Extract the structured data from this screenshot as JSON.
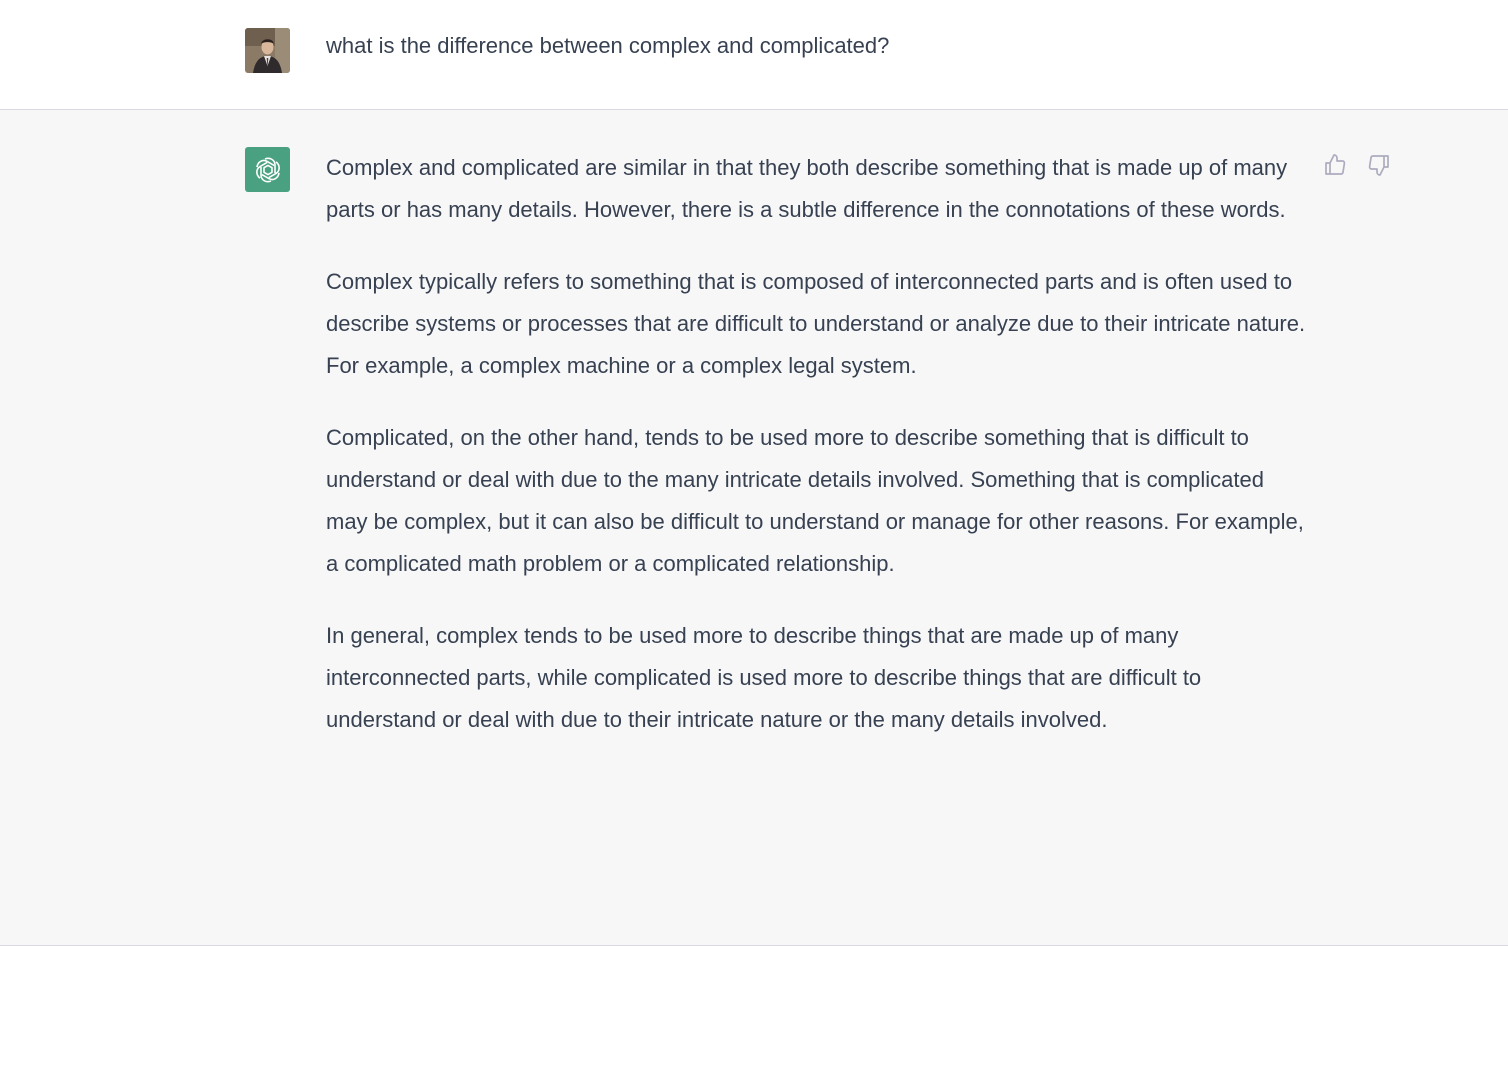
{
  "user_message": {
    "text": "what is the difference between complex and complicated?"
  },
  "assistant_message": {
    "paragraphs": [
      "Complex and complicated are similar in that they both describe something that is made up of many parts or has many details. However, there is a subtle difference in the connotations of these words.",
      "Complex typically refers to something that is composed of interconnected parts and is often used to describe systems or processes that are difficult to understand or analyze due to their intricate nature. For example, a complex machine or a complex legal system.",
      "Complicated, on the other hand, tends to be used more to describe something that is difficult to understand or deal with due to the many intricate details involved. Something that is complicated may be complex, but it can also be difficult to understand or manage for other reasons. For example, a complicated math problem or a complicated relationship.",
      "In general, complex tends to be used more to describe things that are made up of many interconnected parts, while complicated is used more to describe things that are difficult to understand or deal with due to their intricate nature or the many details involved."
    ]
  },
  "icons": {
    "assistant_avatar": "openai-logo-icon",
    "thumbs_up": "thumbs-up-icon",
    "thumbs_down": "thumbs-down-icon"
  },
  "colors": {
    "assistant_avatar_bg": "#4aa181",
    "assistant_row_bg": "#f7f7f8",
    "text": "#374151"
  }
}
